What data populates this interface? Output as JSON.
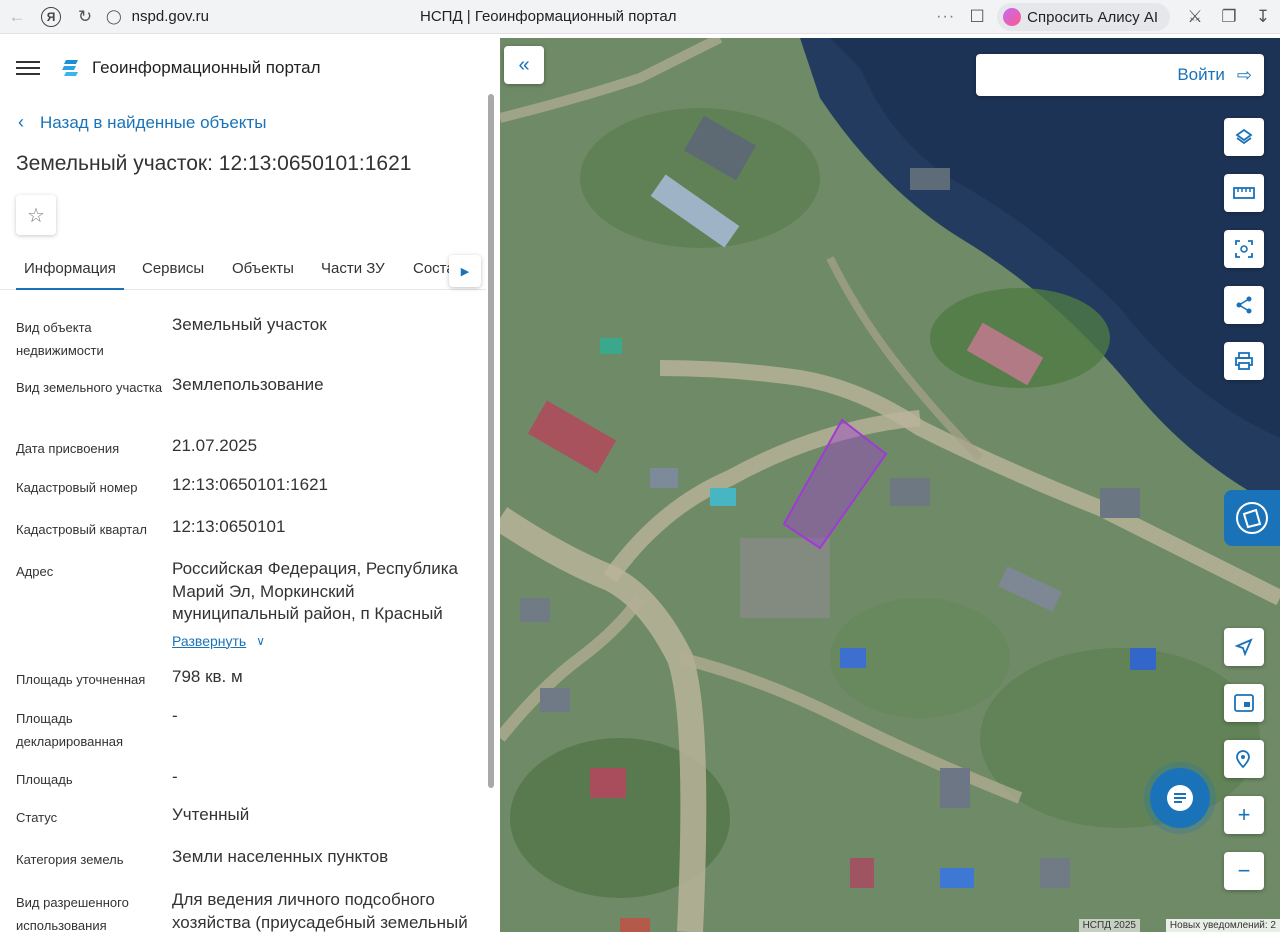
{
  "browser": {
    "url": "nspd.gov.ru",
    "title": "НСПД | Геоинформационный портал",
    "alisa": "Спросить Алису AI",
    "dots": "···"
  },
  "panel": {
    "brand": "Геоинформационный портал",
    "back": "Назад в найденные объекты",
    "title": "Земельный участок: 12:13:0650101:1621",
    "tabs": [
      "Информация",
      "Сервисы",
      "Объекты",
      "Части ЗУ",
      "Состав"
    ],
    "active_tab": "Информация",
    "expand": "Развернуть",
    "fields": [
      {
        "label": "Вид объекта недвижимости",
        "value": "Земельный участок"
      },
      {
        "label": "Вид земельного участка",
        "value": "Землепользование"
      },
      {
        "label": "Дата присвоения",
        "value": "21.07.2025"
      },
      {
        "label": "Кадастровый номер",
        "value": "12:13:0650101:1621"
      },
      {
        "label": "Кадастровый квартал",
        "value": "12:13:0650101"
      },
      {
        "label": "Адрес",
        "value": "Российская Федерация, Республика Марий Эл, Моркинский муниципальный район, п Красный"
      },
      {
        "label": "Площадь уточненная",
        "value": "798 кв. м"
      },
      {
        "label": "Площадь декларированная",
        "value": "-"
      },
      {
        "label": "Площадь",
        "value": "-"
      },
      {
        "label": "Статус",
        "value": "Учтенный"
      },
      {
        "label": "Категория земель",
        "value": "Земли населенных пунктов"
      },
      {
        "label": "Вид разрешенного использования",
        "value": "Для ведения личного подсобного хозяйства (приусадебный земельный"
      }
    ]
  },
  "map": {
    "login": "Войти",
    "attribution": "НСПД 2025",
    "notice": "Новых уведомлений: 2",
    "tools": [
      "layers-icon",
      "ruler-icon",
      "select-area-icon",
      "share-icon",
      "print-icon"
    ],
    "nav": [
      "locate-icon",
      "minimap-icon",
      "search-location-icon",
      "zoom-in-icon",
      "zoom-out-icon"
    ],
    "parcel_color": "#a03ad6",
    "accent": "#1a73b8"
  }
}
